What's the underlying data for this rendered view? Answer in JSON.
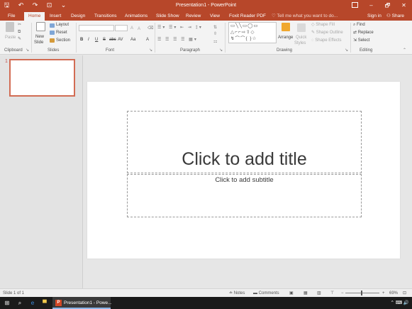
{
  "window": {
    "title": "Presentation1 - PowerPoint",
    "qat_icons": [
      "save-icon",
      "undo-icon",
      "redo-icon",
      "start-from-beginning-icon",
      "customize-qat-icon"
    ],
    "qat_glyphs": [
      "🖫",
      "↶",
      "↷",
      "⊡",
      "⌄"
    ],
    "controls": {
      "minimize": "–",
      "maximize": "🗗",
      "close": "✕",
      "ribbon_display": ""
    }
  },
  "tabs": {
    "items": [
      "File",
      "Home",
      "Insert",
      "Design",
      "Transitions",
      "Animations",
      "Slide Show",
      "Review",
      "View",
      "Foxit Reader PDF"
    ],
    "active": "Home",
    "tell_me": "Tell me what you want to do...",
    "sign_in": "Sign in",
    "share": "Share"
  },
  "ribbon": {
    "clipboard": {
      "label": "Clipboard",
      "paste": "Paste"
    },
    "slides": {
      "label": "Slides",
      "new_slide": "New",
      "new_slide_2": "Slide",
      "layout": "Layout",
      "reset": "Reset",
      "section": "Section"
    },
    "font": {
      "label": "Font",
      "bold": "B",
      "italic": "I",
      "underline": "U",
      "strike": "S",
      "abc": "abc",
      "av": "AV",
      "aa": "Aa",
      "a": "A",
      "grow": "A",
      "shrink": "A"
    },
    "paragraph": {
      "label": "Paragraph"
    },
    "drawing": {
      "label": "Drawing",
      "arrange": "Arrange",
      "quick_styles": "Quick",
      "quick_styles_2": "Styles",
      "shape_fill": "Shape Fill",
      "shape_outline": "Shape Outline",
      "shape_effects": "Shape Effects"
    },
    "editing": {
      "label": "Editing",
      "find": "Find",
      "replace": "Replace",
      "select": "Select"
    }
  },
  "slide_pane": {
    "number": "1"
  },
  "slide": {
    "title_placeholder": "Click to add title",
    "subtitle_placeholder": "Click to add subtitle"
  },
  "status": {
    "slide_info": "Slide 1 of 1",
    "notes": "Notes",
    "comments": "Comments",
    "zoom": "69%"
  },
  "taskbar": {
    "app_label": "Presentation1 - Powe...",
    "app_badge": "P"
  },
  "colors": {
    "accent": "#b7472a",
    "thumb_border": "#d26c54"
  }
}
